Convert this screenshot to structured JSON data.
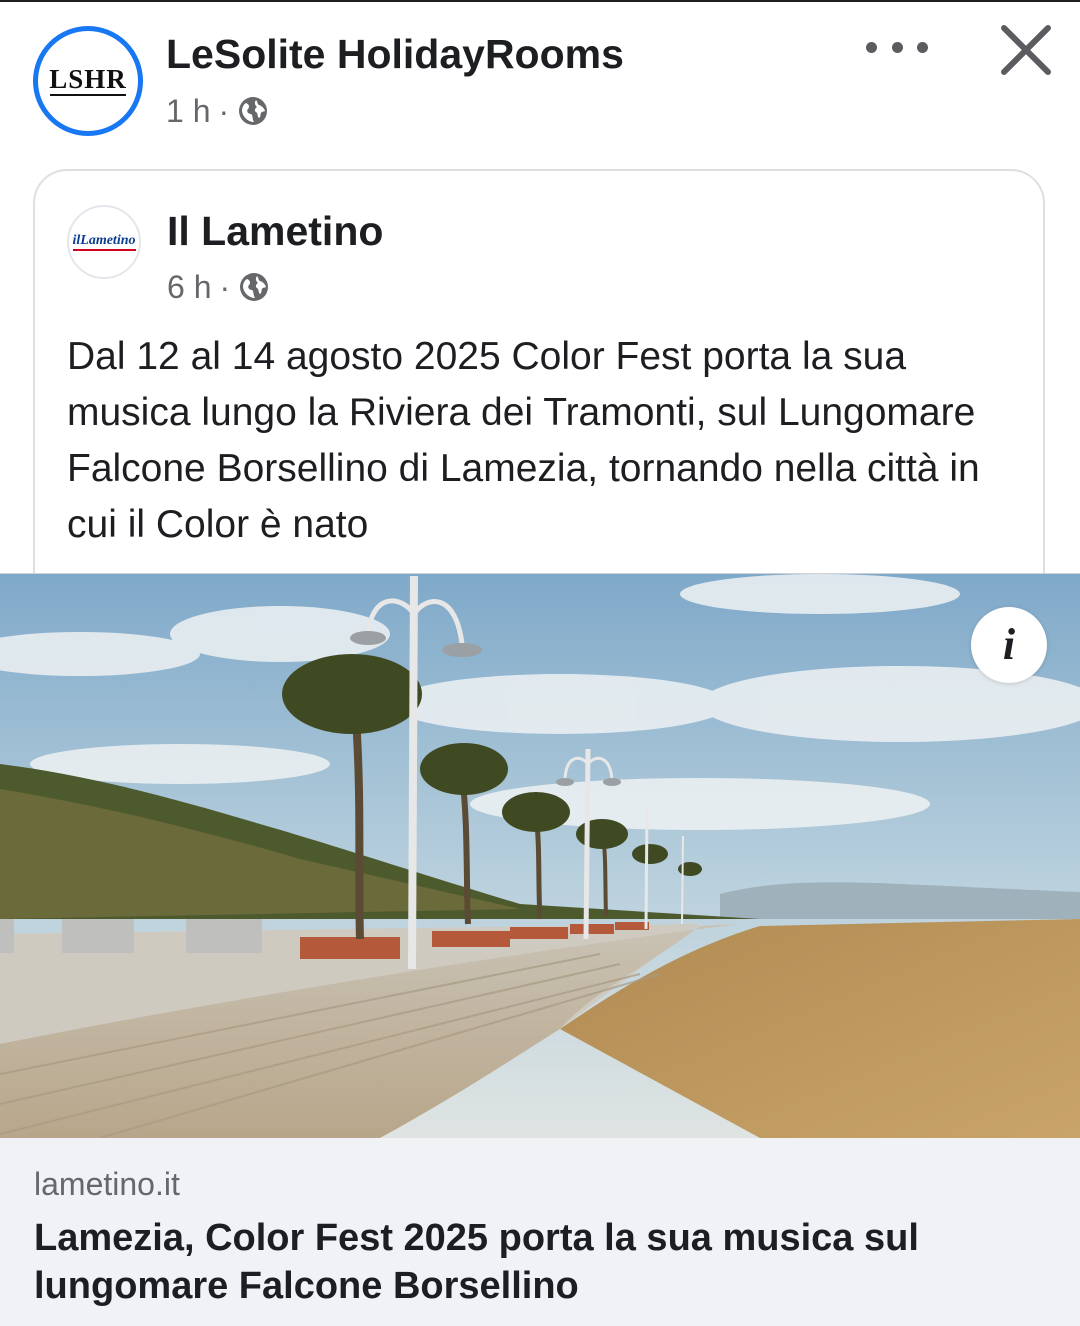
{
  "post": {
    "page_name": "LeSolite HolidayRooms",
    "avatar_text": "LSHR",
    "time": "1 h",
    "separator": "·",
    "audience_icon": "globe-icon",
    "more_icon": "more-horizontal-icon",
    "close_icon": "close-icon"
  },
  "shared": {
    "source_name": "Il Lametino",
    "avatar_text": "ilLametino",
    "time": "6 h",
    "separator": "·",
    "audience_icon": "globe-icon",
    "text": "Dal 12 al 14 agosto 2025 Color Fest porta la sua musica lungo la Riviera dei Tramonti, sul Lungomare Falcone Borsellino di Lamezia, tornando nella città in cui il Color è nato"
  },
  "link_preview": {
    "info_icon": "info-icon",
    "domain": "lametino.it",
    "title": "Lamezia, Color Fest 2025 porta la sua musica sul lungomare Falcone Borsellino"
  },
  "colors": {
    "accent": "#1877f2",
    "text_primary": "#1c1e21",
    "text_secondary": "#65676b",
    "footer_bg": "#f0f2f5"
  }
}
